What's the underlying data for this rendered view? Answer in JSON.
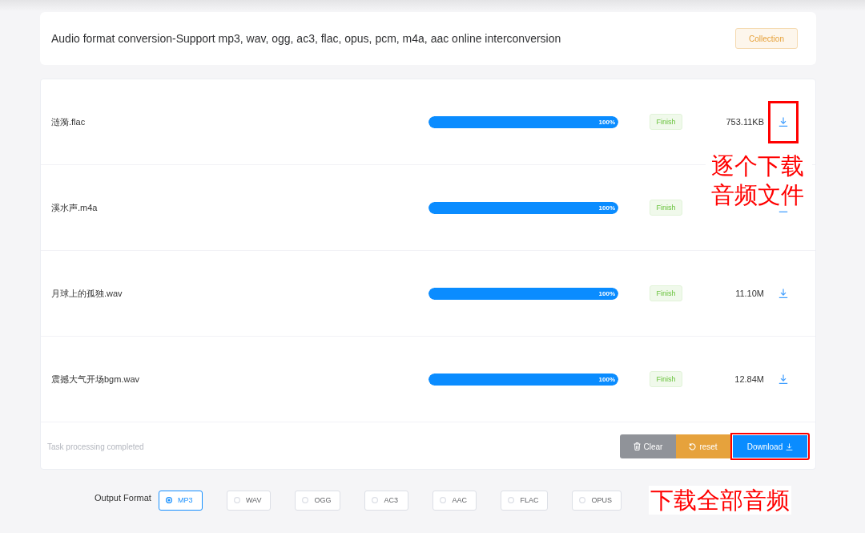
{
  "header": {
    "title": "Audio format conversion-Support mp3, wav, ogg, ac3, flac, opus, pcm, m4a, aac online interconversion",
    "collection_button": "Collection"
  },
  "files": [
    {
      "name": "涟漪.flac",
      "level": 1,
      "percent": "100%",
      "status": "Finish",
      "size": "753.11KB",
      "highlighted": true
    },
    {
      "name": "溪水声.m4a",
      "level": 1,
      "percent": "100%",
      "status": "Finish",
      "highlighted": false
    },
    {
      "name": "月球上的孤独.wav",
      "level": 1,
      "percent": "100%",
      "status": "Finish",
      "size": "11.10M",
      "highlighted": false
    },
    {
      "name": "震撼大气开场bgm.wav",
      "level": 1,
      "percent": "100%",
      "status": "Finish",
      "size": "12.84M",
      "highlighted": false
    }
  ],
  "footer": {
    "message": "Task processing completed",
    "buttons": [
      {
        "kind": "clear",
        "label": "Clear",
        "highlighted": false
      },
      {
        "kind": "reset",
        "label": "reset",
        "highlighted": false
      },
      {
        "kind": "download",
        "label": "Download",
        "highlighted": true
      }
    ]
  },
  "output_format": {
    "label": "Output Format",
    "options": [
      {
        "label": "MP3",
        "selected": true
      },
      {
        "label": "WAV",
        "selected": false
      },
      {
        "label": "OGG",
        "selected": false
      },
      {
        "label": "AC3",
        "selected": false
      },
      {
        "label": "AAC",
        "selected": false
      },
      {
        "label": "FLAC",
        "selected": false
      },
      {
        "label": "OPUS",
        "selected": false
      }
    ]
  },
  "annotations": [
    {
      "kind": "overlay",
      "text": "逐个下载音频文件"
    },
    {
      "kind": "inline",
      "text": "下载全部音频"
    }
  ]
}
